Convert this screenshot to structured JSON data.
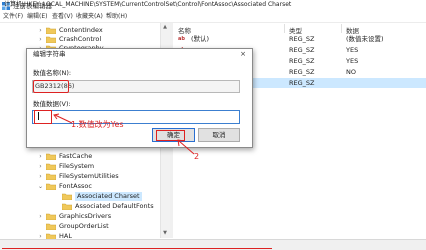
{
  "window": {
    "title": "注册表编辑器",
    "app_icon": "registry-editor-icon"
  },
  "menu": [
    "文件(F)",
    "编辑(E)",
    "查看(V)",
    "收藏夹(A)",
    "帮助(H)"
  ],
  "tree": {
    "items": [
      {
        "label": "ContentIndex",
        "expander": "collapsed"
      },
      {
        "label": "CrashControl",
        "expander": "collapsed"
      },
      {
        "label": "Cryptography",
        "expander": "collapsed"
      },
      {
        "label": "FastCache",
        "expander": "collapsed"
      },
      {
        "label": "FileSystem",
        "expander": "collapsed"
      },
      {
        "label": "FileSystemUtilities",
        "expander": "collapsed"
      },
      {
        "label": "FontAssoc",
        "expander": "expanded"
      },
      {
        "label": "Associated Charset",
        "expander": "none"
      },
      {
        "label": "Associated DefaultFonts",
        "expander": "none"
      },
      {
        "label": "GraphicsDrivers",
        "expander": "collapsed"
      },
      {
        "label": "GroupOrderList",
        "expander": "none"
      },
      {
        "label": "HAL",
        "expander": "collapsed"
      }
    ],
    "selected": "Associated Charset"
  },
  "list": {
    "headers": {
      "name": "名称",
      "type": "类型",
      "data": "数据"
    },
    "rows": [
      {
        "name": "(默认)",
        "type": "REG_SZ",
        "data": "(数值未设置)"
      },
      {
        "name": "",
        "type": "REG_SZ",
        "data": "YES"
      },
      {
        "name": "",
        "type": "REG_SZ",
        "data": "YES"
      },
      {
        "name": "",
        "type": "REG_SZ",
        "data": "NO"
      },
      {
        "name": "",
        "type": "REG_SZ",
        "data": ""
      }
    ]
  },
  "dialog": {
    "title": "编辑字符串",
    "close": "×",
    "name_label": "数值名称(N):",
    "name_value": "GB2312(86)",
    "data_label": "数值数据(V):",
    "data_value": "",
    "ok_label": "确定",
    "cancel_label": "取消"
  },
  "annotations": {
    "step1": "1.数值改为Yes",
    "step2": "2",
    "color": "#d22222"
  },
  "status": {
    "path": "计算机\\HKEY_LOCAL_MACHINE\\SYSTEM\\CurrentControlSet\\Control\\FontAssoc\\Associated Charset"
  }
}
